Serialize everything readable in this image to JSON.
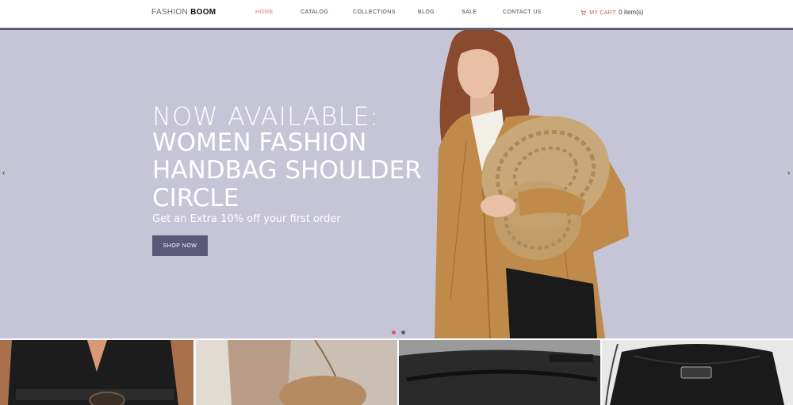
{
  "header": {
    "logo": {
      "light": "FASHION",
      "bold": "BOOM"
    },
    "nav": [
      {
        "label": "HOME",
        "active": true
      },
      {
        "label": "CATALOG",
        "active": false
      },
      {
        "label": "COLLECTIONS",
        "active": false
      },
      {
        "label": "BLOG",
        "active": false
      },
      {
        "label": "SALE",
        "active": false
      },
      {
        "label": "CONTACT US",
        "active": false
      }
    ],
    "cart": {
      "label": "MY CART:",
      "count": "0 item(s)",
      "icon": "cart-icon"
    }
  },
  "hero": {
    "line1": "NOW AVAILABLE:",
    "line2a": "WOMEN FASHION",
    "line2b": "HANDBAG SHOULDER",
    "line2c": "CIRCLE",
    "subtitle": "Get an Extra 10% off your first order",
    "button": "SHOP NOW",
    "background": "#c6c4d7",
    "slides": 2,
    "active_slide": 1,
    "dot_active_color": "#e05a5a",
    "dot_inactive_color": "#5a5a78",
    "prev_icon": "chevron-left-icon",
    "next_icon": "chevron-right-icon"
  },
  "colors": {
    "accent": "#e07a85",
    "button": "#5a5a78",
    "cart_label": "#d9534f"
  }
}
